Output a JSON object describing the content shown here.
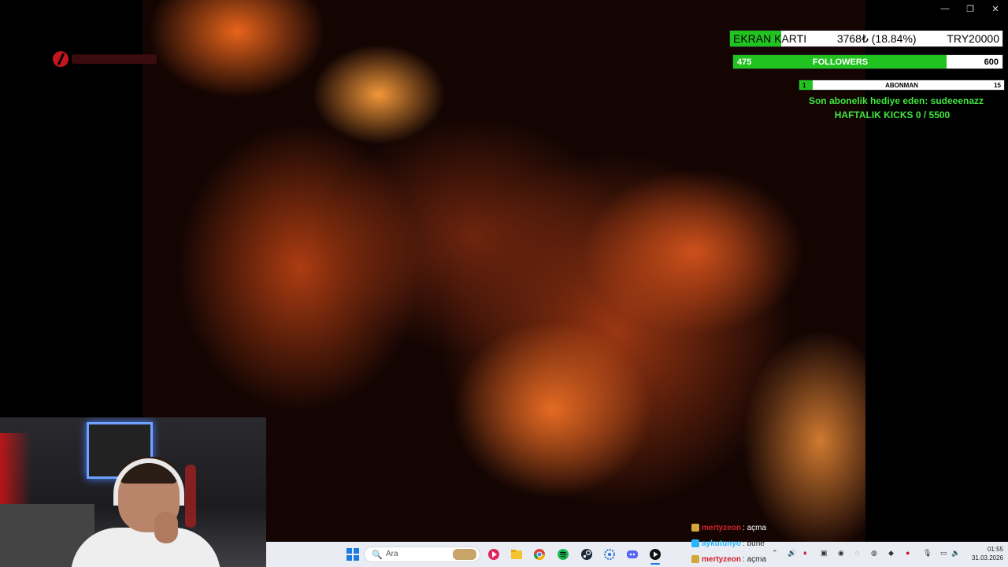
{
  "window_controls": {
    "minimize": "—",
    "maximize": "❐",
    "close": "✕"
  },
  "overlay": {
    "goal": {
      "label": "EKRAN KARTI",
      "amount": "3768₺ (18.84%)",
      "target": "TRY20000",
      "progress_pct": 18.84
    },
    "followers": {
      "current": "475",
      "label": "FOLLOWERS",
      "target": "600",
      "progress_pct": 79.17
    },
    "abonman": {
      "current": "1",
      "label": "ABONMAN",
      "target": "15",
      "progress_pct": 6.67
    },
    "gift_text": "Son abonelik hediye eden: sudeeenazz",
    "kicks_text": "HAFTALIK KICKS 0 / 5500"
  },
  "chat": [
    {
      "user": "mertyzeon",
      "message": ": açma",
      "user_color": "#d41f2c",
      "badge_color": "#d4a73a"
    },
    {
      "user": "aykutunyo",
      "message": ": bune",
      "user_color": "#27b6ff",
      "badge_color": "#27b6ff"
    },
    {
      "user": "mertyzeon",
      "message": ": açma",
      "user_color": "#d41f2c",
      "badge_color": "#d4a73a"
    }
  ],
  "taskbar": {
    "search_placeholder": "Ara",
    "icons": [
      "windows-start-icon",
      "search-icon",
      "media-player-icon",
      "file-explorer-icon",
      "chrome-icon",
      "spotify-icon",
      "steam-icon",
      "settings-icon",
      "discord-icon",
      "player-icon"
    ],
    "clock_time": "01:55",
    "clock_date": "31.03.2026"
  },
  "colors": {
    "progress_green": "#21c321",
    "overlay_text_green": "#3ee63e",
    "taskbar_bg": "#e9edf3"
  }
}
